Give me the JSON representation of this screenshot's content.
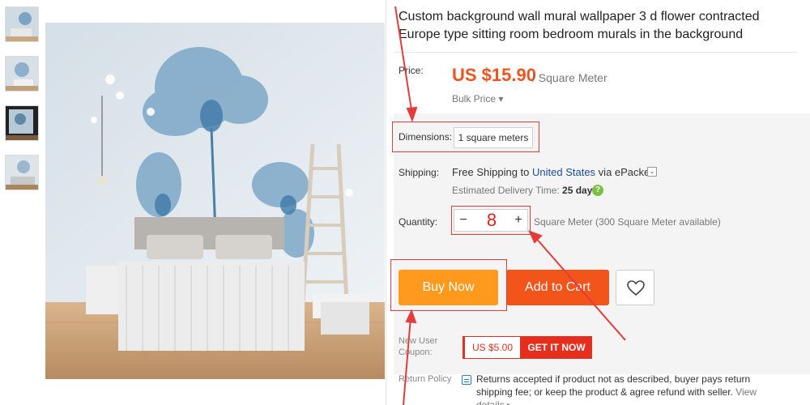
{
  "product": {
    "title": "Custom background wall mural wallpaper 3 d flower contracted Europe type sitting room bedroom murals in the background"
  },
  "price": {
    "label": "Price:",
    "value": "US $15.90",
    "unit": "/ Square Meter",
    "bulk": "Bulk Price ▾"
  },
  "dimensions": {
    "label": "Dimensions:",
    "value": "1 square meters"
  },
  "shipping": {
    "label": "Shipping:",
    "prefix": "Free Shipping to ",
    "country": "United States",
    "suffix": " via ePacket",
    "dropdown_icon": "⌄",
    "estimate_label": "Estimated Delivery Time:",
    "estimate_value": "25 days",
    "help_icon": "?"
  },
  "quantity": {
    "label": "Quantity:",
    "minus": "−",
    "value": "8",
    "plus": "+",
    "note": "Square Meter (300 Square Meter available)"
  },
  "buttons": {
    "buy_now": "Buy Now",
    "add_to_cart": "Add to Cart"
  },
  "coupon": {
    "label": "New User Coupon:",
    "amount": "US $5.00",
    "action": "GET IT NOW"
  },
  "return_policy": {
    "label": "Return Policy",
    "text": "Returns accepted if product not as described, buyer pays return shipping fee; or keep the product & agree refund with seller. ",
    "link": "View details ▸"
  },
  "colors": {
    "price": "#f0541e",
    "buy_now": "#ff9a1e",
    "add_to_cart": "#f2541a",
    "coupon": "#e62e1c",
    "annotation": "#e53b3b"
  }
}
